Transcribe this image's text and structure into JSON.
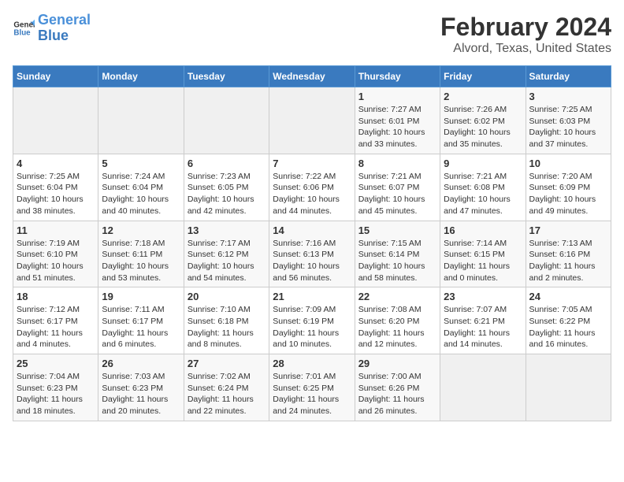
{
  "logo": {
    "line1": "General",
    "line2": "Blue"
  },
  "title": "February 2024",
  "subtitle": "Alvord, Texas, United States",
  "weekdays": [
    "Sunday",
    "Monday",
    "Tuesday",
    "Wednesday",
    "Thursday",
    "Friday",
    "Saturday"
  ],
  "weeks": [
    [
      {
        "day": "",
        "info": ""
      },
      {
        "day": "",
        "info": ""
      },
      {
        "day": "",
        "info": ""
      },
      {
        "day": "",
        "info": ""
      },
      {
        "day": "1",
        "info": "Sunrise: 7:27 AM\nSunset: 6:01 PM\nDaylight: 10 hours and 33 minutes."
      },
      {
        "day": "2",
        "info": "Sunrise: 7:26 AM\nSunset: 6:02 PM\nDaylight: 10 hours and 35 minutes."
      },
      {
        "day": "3",
        "info": "Sunrise: 7:25 AM\nSunset: 6:03 PM\nDaylight: 10 hours and 37 minutes."
      }
    ],
    [
      {
        "day": "4",
        "info": "Sunrise: 7:25 AM\nSunset: 6:04 PM\nDaylight: 10 hours and 38 minutes."
      },
      {
        "day": "5",
        "info": "Sunrise: 7:24 AM\nSunset: 6:04 PM\nDaylight: 10 hours and 40 minutes."
      },
      {
        "day": "6",
        "info": "Sunrise: 7:23 AM\nSunset: 6:05 PM\nDaylight: 10 hours and 42 minutes."
      },
      {
        "day": "7",
        "info": "Sunrise: 7:22 AM\nSunset: 6:06 PM\nDaylight: 10 hours and 44 minutes."
      },
      {
        "day": "8",
        "info": "Sunrise: 7:21 AM\nSunset: 6:07 PM\nDaylight: 10 hours and 45 minutes."
      },
      {
        "day": "9",
        "info": "Sunrise: 7:21 AM\nSunset: 6:08 PM\nDaylight: 10 hours and 47 minutes."
      },
      {
        "day": "10",
        "info": "Sunrise: 7:20 AM\nSunset: 6:09 PM\nDaylight: 10 hours and 49 minutes."
      }
    ],
    [
      {
        "day": "11",
        "info": "Sunrise: 7:19 AM\nSunset: 6:10 PM\nDaylight: 10 hours and 51 minutes."
      },
      {
        "day": "12",
        "info": "Sunrise: 7:18 AM\nSunset: 6:11 PM\nDaylight: 10 hours and 53 minutes."
      },
      {
        "day": "13",
        "info": "Sunrise: 7:17 AM\nSunset: 6:12 PM\nDaylight: 10 hours and 54 minutes."
      },
      {
        "day": "14",
        "info": "Sunrise: 7:16 AM\nSunset: 6:13 PM\nDaylight: 10 hours and 56 minutes."
      },
      {
        "day": "15",
        "info": "Sunrise: 7:15 AM\nSunset: 6:14 PM\nDaylight: 10 hours and 58 minutes."
      },
      {
        "day": "16",
        "info": "Sunrise: 7:14 AM\nSunset: 6:15 PM\nDaylight: 11 hours and 0 minutes."
      },
      {
        "day": "17",
        "info": "Sunrise: 7:13 AM\nSunset: 6:16 PM\nDaylight: 11 hours and 2 minutes."
      }
    ],
    [
      {
        "day": "18",
        "info": "Sunrise: 7:12 AM\nSunset: 6:17 PM\nDaylight: 11 hours and 4 minutes."
      },
      {
        "day": "19",
        "info": "Sunrise: 7:11 AM\nSunset: 6:17 PM\nDaylight: 11 hours and 6 minutes."
      },
      {
        "day": "20",
        "info": "Sunrise: 7:10 AM\nSunset: 6:18 PM\nDaylight: 11 hours and 8 minutes."
      },
      {
        "day": "21",
        "info": "Sunrise: 7:09 AM\nSunset: 6:19 PM\nDaylight: 11 hours and 10 minutes."
      },
      {
        "day": "22",
        "info": "Sunrise: 7:08 AM\nSunset: 6:20 PM\nDaylight: 11 hours and 12 minutes."
      },
      {
        "day": "23",
        "info": "Sunrise: 7:07 AM\nSunset: 6:21 PM\nDaylight: 11 hours and 14 minutes."
      },
      {
        "day": "24",
        "info": "Sunrise: 7:05 AM\nSunset: 6:22 PM\nDaylight: 11 hours and 16 minutes."
      }
    ],
    [
      {
        "day": "25",
        "info": "Sunrise: 7:04 AM\nSunset: 6:23 PM\nDaylight: 11 hours and 18 minutes."
      },
      {
        "day": "26",
        "info": "Sunrise: 7:03 AM\nSunset: 6:23 PM\nDaylight: 11 hours and 20 minutes."
      },
      {
        "day": "27",
        "info": "Sunrise: 7:02 AM\nSunset: 6:24 PM\nDaylight: 11 hours and 22 minutes."
      },
      {
        "day": "28",
        "info": "Sunrise: 7:01 AM\nSunset: 6:25 PM\nDaylight: 11 hours and 24 minutes."
      },
      {
        "day": "29",
        "info": "Sunrise: 7:00 AM\nSunset: 6:26 PM\nDaylight: 11 hours and 26 minutes."
      },
      {
        "day": "",
        "info": ""
      },
      {
        "day": "",
        "info": ""
      }
    ]
  ]
}
